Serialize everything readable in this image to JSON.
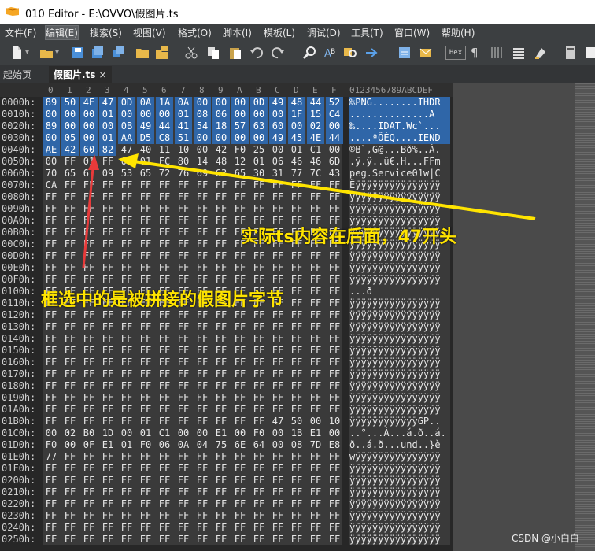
{
  "window": {
    "title": "010 Editor - E:\\OVVO\\假图片.ts"
  },
  "menu": [
    "文件(F)",
    "编辑(E)",
    "搜索(S)",
    "视图(V)",
    "格式(O)",
    "脚本(I)",
    "模板(L)",
    "调试(D)",
    "工具(T)",
    "窗口(W)",
    "帮助(H)"
  ],
  "tabs": [
    {
      "label": "起始页"
    },
    {
      "label": "假图片.ts",
      "close": "×"
    }
  ],
  "toolbar": {
    "hex_label": "Hex"
  },
  "hex_header": {
    "columns": [
      "0",
      "1",
      "2",
      "3",
      "4",
      "5",
      "6",
      "7",
      "8",
      "9",
      "A",
      "B",
      "C",
      "D",
      "E",
      "F"
    ],
    "ascii_header": "0123456789ABCDEF"
  },
  "rows": [
    {
      "addr": "0000h:",
      "bytes": [
        "89",
        "50",
        "4E",
        "47",
        "0D",
        "0A",
        "1A",
        "0A",
        "00",
        "00",
        "00",
        "0D",
        "49",
        "48",
        "44",
        "52"
      ],
      "ascii": "‰PNG........IHDR"
    },
    {
      "addr": "0010h:",
      "bytes": [
        "00",
        "00",
        "00",
        "01",
        "00",
        "00",
        "00",
        "01",
        "08",
        "06",
        "00",
        "00",
        "00",
        "1F",
        "15",
        "C4"
      ],
      "ascii": "..............Ä"
    },
    {
      "addr": "0020h:",
      "bytes": [
        "89",
        "00",
        "00",
        "00",
        "0B",
        "49",
        "44",
        "41",
        "54",
        "18",
        "57",
        "63",
        "60",
        "00",
        "02",
        "00"
      ],
      "ascii": "‰....IDAT.Wc`..."
    },
    {
      "addr": "0030h:",
      "bytes": [
        "00",
        "05",
        "00",
        "01",
        "AA",
        "D5",
        "C8",
        "51",
        "00",
        "00",
        "00",
        "00",
        "49",
        "45",
        "4E",
        "44"
      ],
      "ascii": "....ªÕÈQ....IEND"
    },
    {
      "addr": "0040h:",
      "bytes": [
        "AE",
        "42",
        "60",
        "82",
        "47",
        "40",
        "11",
        "10",
        "00",
        "42",
        "F0",
        "25",
        "00",
        "01",
        "C1",
        "00"
      ],
      "ascii": "®B`‚G@...Bð%..Á."
    },
    {
      "addr": "0050h:",
      "bytes": [
        "00",
        "FF",
        "01",
        "FF",
        "00",
        "01",
        "FC",
        "80",
        "14",
        "48",
        "12",
        "01",
        "06",
        "46",
        "46",
        "6D"
      ],
      "ascii": ".ÿ.ÿ..ü€.H...FFm"
    },
    {
      "addr": "0060h:",
      "bytes": [
        "70",
        "65",
        "67",
        "09",
        "53",
        "65",
        "72",
        "76",
        "69",
        "63",
        "65",
        "30",
        "31",
        "77",
        "7C",
        "43"
      ],
      "ascii": "peg.Service01w|C"
    },
    {
      "addr": "0070h:",
      "bytes": [
        "CA",
        "FF",
        "FF",
        "FF",
        "FF",
        "FF",
        "FF",
        "FF",
        "FF",
        "FF",
        "FF",
        "FF",
        "FF",
        "FF",
        "FF",
        "FF"
      ],
      "ascii": "Êÿÿÿÿÿÿÿÿÿÿÿÿÿÿÿ"
    },
    {
      "addr": "0080h:",
      "bytes": [
        "FF",
        "FF",
        "FF",
        "FF",
        "FF",
        "FF",
        "FF",
        "FF",
        "FF",
        "FF",
        "FF",
        "FF",
        "FF",
        "FF",
        "FF",
        "FF"
      ],
      "ascii": "ÿÿÿÿÿÿÿÿÿÿÿÿÿÿÿÿ"
    },
    {
      "addr": "0090h:",
      "bytes": [
        "FF",
        "FF",
        "FF",
        "FF",
        "FF",
        "FF",
        "FF",
        "FF",
        "FF",
        "FF",
        "FF",
        "FF",
        "FF",
        "FF",
        "FF",
        "FF"
      ],
      "ascii": "ÿÿÿÿÿÿÿÿÿÿÿÿÿÿÿÿ"
    },
    {
      "addr": "00A0h:",
      "bytes": [
        "FF",
        "FF",
        "FF",
        "FF",
        "FF",
        "FF",
        "FF",
        "FF",
        "FF",
        "FF",
        "FF",
        "FF",
        "FF",
        "FF",
        "FF",
        "FF"
      ],
      "ascii": "ÿÿÿÿÿÿÿÿÿÿÿÿÿÿÿÿ"
    },
    {
      "addr": "00B0h:",
      "bytes": [
        "FF",
        "FF",
        "FF",
        "FF",
        "FF",
        "FF",
        "FF",
        "FF",
        "FF",
        "FF",
        "FF",
        "FF",
        "FF",
        "FF",
        "FF",
        "FF"
      ],
      "ascii": "ÿÿÿÿÿÿÿÿÿÿÿÿÿÿÿÿ"
    },
    {
      "addr": "00C0h:",
      "bytes": [
        "FF",
        "FF",
        "FF",
        "FF",
        "FF",
        "FF",
        "FF",
        "FF",
        "FF",
        "FF",
        "FF",
        "FF",
        "FF",
        "FF",
        "FF",
        "FF"
      ],
      "ascii": "ÿÿÿÿÿÿÿÿÿÿÿÿÿÿÿÿ"
    },
    {
      "addr": "00D0h:",
      "bytes": [
        "FF",
        "FF",
        "FF",
        "FF",
        "FF",
        "FF",
        "FF",
        "FF",
        "FF",
        "FF",
        "FF",
        "FF",
        "FF",
        "FF",
        "FF",
        "FF"
      ],
      "ascii": "ÿÿÿÿÿÿÿÿÿÿÿÿÿÿÿÿ"
    },
    {
      "addr": "00E0h:",
      "bytes": [
        "FF",
        "FF",
        "FF",
        "FF",
        "FF",
        "FF",
        "FF",
        "FF",
        "FF",
        "FF",
        "FF",
        "FF",
        "FF",
        "FF",
        "FF",
        "FF"
      ],
      "ascii": "ÿÿÿÿÿÿÿÿÿÿÿÿÿÿÿÿ"
    },
    {
      "addr": "00F0h:",
      "bytes": [
        "FF",
        "FF",
        "FF",
        "FF",
        "FF",
        "FF",
        "FF",
        "FF",
        "FF",
        "FF",
        "FF",
        "FF",
        "FF",
        "FF",
        "FF",
        "FF"
      ],
      "ascii": "ÿÿÿÿÿÿÿÿÿÿÿÿÿÿÿÿ"
    },
    {
      "addr": "0100h:",
      "bytes": [
        "FF",
        "FF",
        "FF",
        "FF",
        "FF",
        "FF",
        "FF",
        "FF",
        "FF",
        "FF",
        "FF",
        "FF",
        "FF",
        "FF",
        "FF",
        "FF"
      ],
      "ascii": "...ð"
    },
    {
      "addr": "0110h:",
      "bytes": [
        "FF",
        "FF",
        "FF",
        "FF",
        "FF",
        "FF",
        "FF",
        "FF",
        "FF",
        "FF",
        "FF",
        "FF",
        "FF",
        "FF",
        "FF",
        "FF"
      ],
      "ascii": "ÿÿÿÿÿÿÿÿÿÿÿÿÿÿÿÿ"
    },
    {
      "addr": "0120h:",
      "bytes": [
        "FF",
        "FF",
        "FF",
        "FF",
        "FF",
        "FF",
        "FF",
        "FF",
        "FF",
        "FF",
        "FF",
        "FF",
        "FF",
        "FF",
        "FF",
        "FF"
      ],
      "ascii": "ÿÿÿÿÿÿÿÿÿÿÿÿÿÿÿÿ"
    },
    {
      "addr": "0130h:",
      "bytes": [
        "FF",
        "FF",
        "FF",
        "FF",
        "FF",
        "FF",
        "FF",
        "FF",
        "FF",
        "FF",
        "FF",
        "FF",
        "FF",
        "FF",
        "FF",
        "FF"
      ],
      "ascii": "ÿÿÿÿÿÿÿÿÿÿÿÿÿÿÿÿ"
    },
    {
      "addr": "0140h:",
      "bytes": [
        "FF",
        "FF",
        "FF",
        "FF",
        "FF",
        "FF",
        "FF",
        "FF",
        "FF",
        "FF",
        "FF",
        "FF",
        "FF",
        "FF",
        "FF",
        "FF"
      ],
      "ascii": "ÿÿÿÿÿÿÿÿÿÿÿÿÿÿÿÿ"
    },
    {
      "addr": "0150h:",
      "bytes": [
        "FF",
        "FF",
        "FF",
        "FF",
        "FF",
        "FF",
        "FF",
        "FF",
        "FF",
        "FF",
        "FF",
        "FF",
        "FF",
        "FF",
        "FF",
        "FF"
      ],
      "ascii": "ÿÿÿÿÿÿÿÿÿÿÿÿÿÿÿÿ"
    },
    {
      "addr": "0160h:",
      "bytes": [
        "FF",
        "FF",
        "FF",
        "FF",
        "FF",
        "FF",
        "FF",
        "FF",
        "FF",
        "FF",
        "FF",
        "FF",
        "FF",
        "FF",
        "FF",
        "FF"
      ],
      "ascii": "ÿÿÿÿÿÿÿÿÿÿÿÿÿÿÿÿ"
    },
    {
      "addr": "0170h:",
      "bytes": [
        "FF",
        "FF",
        "FF",
        "FF",
        "FF",
        "FF",
        "FF",
        "FF",
        "FF",
        "FF",
        "FF",
        "FF",
        "FF",
        "FF",
        "FF",
        "FF"
      ],
      "ascii": "ÿÿÿÿÿÿÿÿÿÿÿÿÿÿÿÿ"
    },
    {
      "addr": "0180h:",
      "bytes": [
        "FF",
        "FF",
        "FF",
        "FF",
        "FF",
        "FF",
        "FF",
        "FF",
        "FF",
        "FF",
        "FF",
        "FF",
        "FF",
        "FF",
        "FF",
        "FF"
      ],
      "ascii": "ÿÿÿÿÿÿÿÿÿÿÿÿÿÿÿÿ"
    },
    {
      "addr": "0190h:",
      "bytes": [
        "FF",
        "FF",
        "FF",
        "FF",
        "FF",
        "FF",
        "FF",
        "FF",
        "FF",
        "FF",
        "FF",
        "FF",
        "FF",
        "FF",
        "FF",
        "FF"
      ],
      "ascii": "ÿÿÿÿÿÿÿÿÿÿÿÿÿÿÿÿ"
    },
    {
      "addr": "01A0h:",
      "bytes": [
        "FF",
        "FF",
        "FF",
        "FF",
        "FF",
        "FF",
        "FF",
        "FF",
        "FF",
        "FF",
        "FF",
        "FF",
        "FF",
        "FF",
        "FF",
        "FF"
      ],
      "ascii": "ÿÿÿÿÿÿÿÿÿÿÿÿÿÿÿÿ"
    },
    {
      "addr": "01B0h:",
      "bytes": [
        "FF",
        "FF",
        "FF",
        "FF",
        "FF",
        "FF",
        "FF",
        "FF",
        "FF",
        "FF",
        "FF",
        "FF",
        "47",
        "50",
        "00",
        "10"
      ],
      "ascii": "ÿÿÿÿÿÿÿÿÿÿÿÿGP.."
    },
    {
      "addr": "01C0h:",
      "bytes": [
        "00",
        "02",
        "B0",
        "1D",
        "00",
        "01",
        "C1",
        "00",
        "00",
        "E1",
        "00",
        "F0",
        "00",
        "1B",
        "E1",
        "00"
      ],
      "ascii": "..°...Á...á.ð..á."
    },
    {
      "addr": "01D0h:",
      "bytes": [
        "F0",
        "00",
        "0F",
        "E1",
        "01",
        "F0",
        "06",
        "0A",
        "04",
        "75",
        "6E",
        "64",
        "00",
        "08",
        "7D",
        "E8"
      ],
      "ascii": "ð..á.ð...und..}è"
    },
    {
      "addr": "01E0h:",
      "bytes": [
        "77",
        "FF",
        "FF",
        "FF",
        "FF",
        "FF",
        "FF",
        "FF",
        "FF",
        "FF",
        "FF",
        "FF",
        "FF",
        "FF",
        "FF",
        "FF"
      ],
      "ascii": "wÿÿÿÿÿÿÿÿÿÿÿÿÿÿÿ"
    },
    {
      "addr": "01F0h:",
      "bytes": [
        "FF",
        "FF",
        "FF",
        "FF",
        "FF",
        "FF",
        "FF",
        "FF",
        "FF",
        "FF",
        "FF",
        "FF",
        "FF",
        "FF",
        "FF",
        "FF"
      ],
      "ascii": "ÿÿÿÿÿÿÿÿÿÿÿÿÿÿÿÿ"
    },
    {
      "addr": "0200h:",
      "bytes": [
        "FF",
        "FF",
        "FF",
        "FF",
        "FF",
        "FF",
        "FF",
        "FF",
        "FF",
        "FF",
        "FF",
        "FF",
        "FF",
        "FF",
        "FF",
        "FF"
      ],
      "ascii": "ÿÿÿÿÿÿÿÿÿÿÿÿÿÿÿÿ"
    },
    {
      "addr": "0210h:",
      "bytes": [
        "FF",
        "FF",
        "FF",
        "FF",
        "FF",
        "FF",
        "FF",
        "FF",
        "FF",
        "FF",
        "FF",
        "FF",
        "FF",
        "FF",
        "FF",
        "FF"
      ],
      "ascii": "ÿÿÿÿÿÿÿÿÿÿÿÿÿÿÿÿ"
    },
    {
      "addr": "0220h:",
      "bytes": [
        "FF",
        "FF",
        "FF",
        "FF",
        "FF",
        "FF",
        "FF",
        "FF",
        "FF",
        "FF",
        "FF",
        "FF",
        "FF",
        "FF",
        "FF",
        "FF"
      ],
      "ascii": "ÿÿÿÿÿÿÿÿÿÿÿÿÿÿÿÿ"
    },
    {
      "addr": "0230h:",
      "bytes": [
        "FF",
        "FF",
        "FF",
        "FF",
        "FF",
        "FF",
        "FF",
        "FF",
        "FF",
        "FF",
        "FF",
        "FF",
        "FF",
        "FF",
        "FF",
        "FF"
      ],
      "ascii": "ÿÿÿÿÿÿÿÿÿÿÿÿÿÿÿÿ"
    },
    {
      "addr": "0240h:",
      "bytes": [
        "FF",
        "FF",
        "FF",
        "FF",
        "FF",
        "FF",
        "FF",
        "FF",
        "FF",
        "FF",
        "FF",
        "FF",
        "FF",
        "FF",
        "FF",
        "FF"
      ],
      "ascii": "ÿÿÿÿÿÿÿÿÿÿÿÿÿÿÿÿ"
    },
    {
      "addr": "0250h:",
      "bytes": [
        "FF",
        "FF",
        "FF",
        "FF",
        "FF",
        "FF",
        "FF",
        "FF",
        "FF",
        "FF",
        "FF",
        "FF",
        "FF",
        "FF",
        "FF",
        "FF"
      ],
      "ascii": "ÿÿÿÿÿÿÿÿÿÿÿÿÿÿÿÿ"
    }
  ],
  "selection": {
    "selected_byte_count": 68,
    "accent_color": "#2f66a8"
  },
  "annotations": {
    "right_note": "实际ts内容在后面，47开头",
    "left_note": "框选中的是被拼接的假图片字节",
    "color": "#ffe400"
  },
  "watermark": "CSDN @小白白"
}
